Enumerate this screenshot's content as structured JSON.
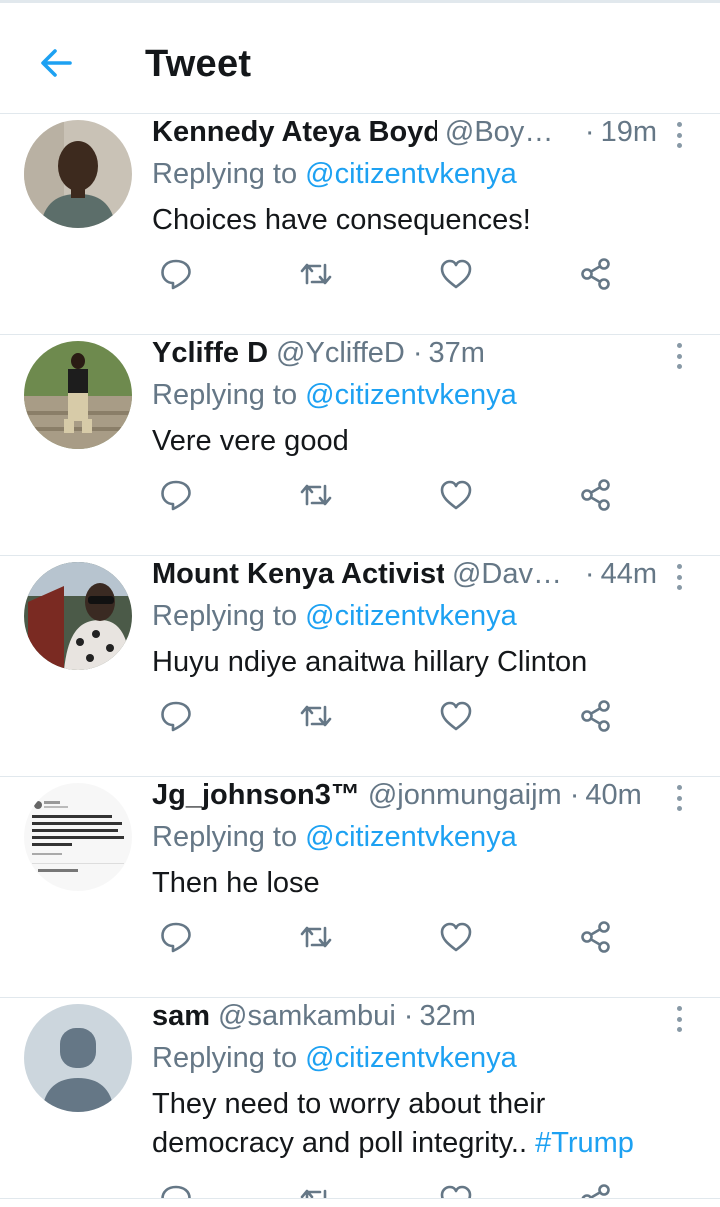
{
  "header": {
    "title": "Tweet",
    "back_icon": "arrow-left-icon"
  },
  "accent_color": "#1da1f2",
  "tweets": [
    {
      "name": "Kennedy Ateya Boyd",
      "handle": "@Boyd...",
      "separator": "·",
      "time": "19m",
      "reply_prefix": "Replying to",
      "reply_to": "@citizentvkenya",
      "text": "Choices have consequences!",
      "hashtag": ""
    },
    {
      "name": "Ycliffe D",
      "handle": "@YcliffeD",
      "separator": "·",
      "time": "37m",
      "reply_prefix": "Replying to",
      "reply_to": "@citizentvkenya",
      "text": "Vere vere good",
      "hashtag": ""
    },
    {
      "name": "Mount Kenya Activist",
      "handle": "@Davi...",
      "separator": "·",
      "time": "44m",
      "reply_prefix": "Replying to",
      "reply_to": "@citizentvkenya",
      "text": "Huyu ndiye anaitwa hillary Clinton",
      "hashtag": ""
    },
    {
      "name": "Jg_johnson3™",
      "handle": "@jonmungaijm",
      "separator": "·",
      "time": "40m",
      "reply_prefix": "Replying to",
      "reply_to": "@citizentvkenya",
      "text": "Then he lose",
      "hashtag": ""
    },
    {
      "name": "sam",
      "handle": "@samkambui",
      "separator": "·",
      "time": "32m",
      "reply_prefix": "Replying to",
      "reply_to": "@citizentvkenya",
      "text": "They need to worry about their democracy and poll integrity.. ",
      "hashtag": "#Trump"
    }
  ],
  "action_icons": [
    "reply-icon",
    "retweet-icon",
    "like-icon",
    "share-icon"
  ]
}
